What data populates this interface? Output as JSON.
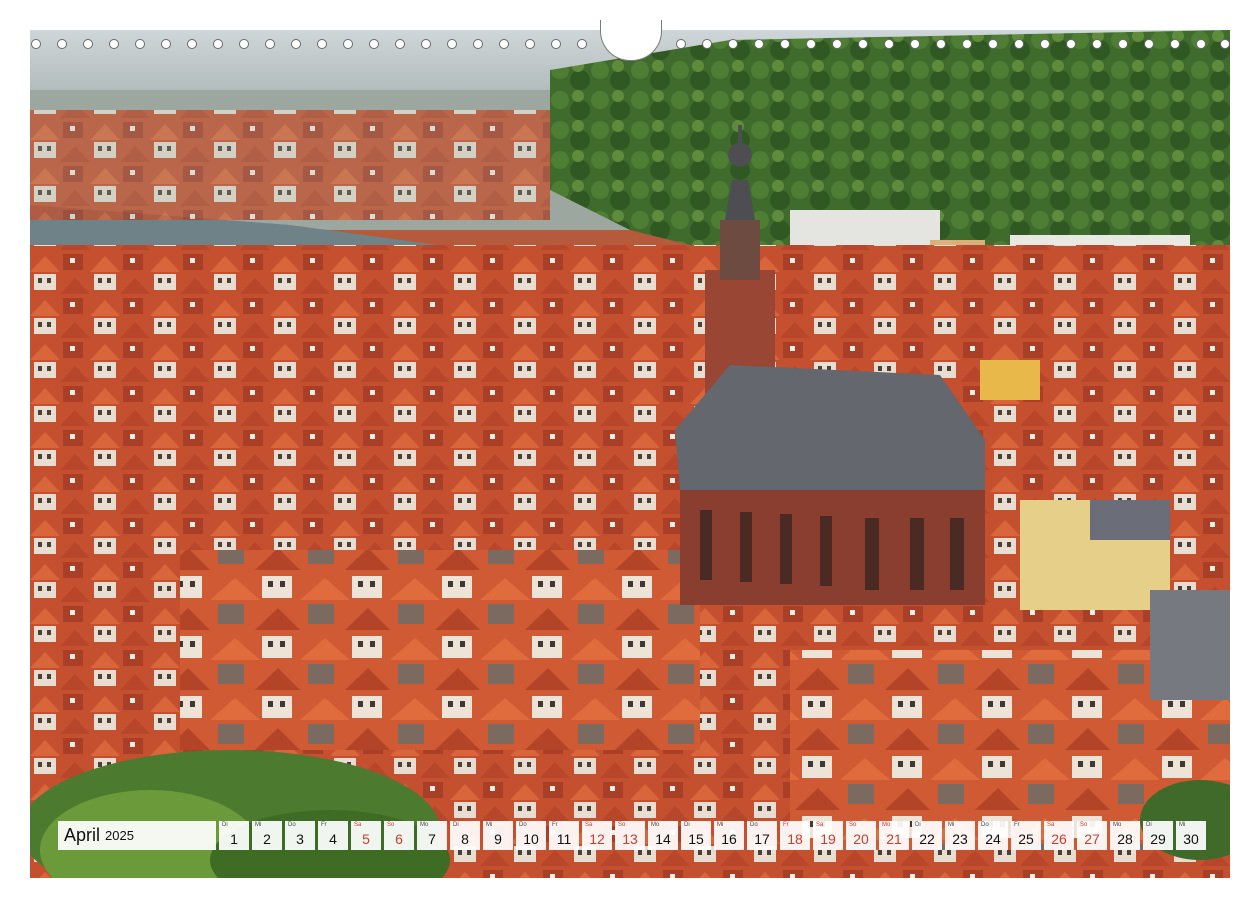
{
  "calendar": {
    "month": "April",
    "year": "2025",
    "days": [
      {
        "wd": "Di",
        "n": "1",
        "we": false
      },
      {
        "wd": "Mi",
        "n": "2",
        "we": false
      },
      {
        "wd": "Do",
        "n": "3",
        "we": false
      },
      {
        "wd": "Fr",
        "n": "4",
        "we": false
      },
      {
        "wd": "Sa",
        "n": "5",
        "we": true
      },
      {
        "wd": "So",
        "n": "6",
        "we": true
      },
      {
        "wd": "Mo",
        "n": "7",
        "we": false
      },
      {
        "wd": "Di",
        "n": "8",
        "we": false
      },
      {
        "wd": "Mi",
        "n": "9",
        "we": false
      },
      {
        "wd": "Do",
        "n": "10",
        "we": false
      },
      {
        "wd": "Fr",
        "n": "11",
        "we": false
      },
      {
        "wd": "Sa",
        "n": "12",
        "we": true
      },
      {
        "wd": "So",
        "n": "13",
        "we": true
      },
      {
        "wd": "Mo",
        "n": "14",
        "we": false
      },
      {
        "wd": "Di",
        "n": "15",
        "we": false
      },
      {
        "wd": "Mi",
        "n": "16",
        "we": false
      },
      {
        "wd": "Do",
        "n": "17",
        "we": false
      },
      {
        "wd": "Fr",
        "n": "18",
        "we": true
      },
      {
        "wd": "Sa",
        "n": "19",
        "we": true
      },
      {
        "wd": "So",
        "n": "20",
        "we": true
      },
      {
        "wd": "Mo",
        "n": "21",
        "we": true
      },
      {
        "wd": "Di",
        "n": "22",
        "we": false
      },
      {
        "wd": "Mi",
        "n": "23",
        "we": false
      },
      {
        "wd": "Do",
        "n": "24",
        "we": false
      },
      {
        "wd": "Fr",
        "n": "25",
        "we": false
      },
      {
        "wd": "Sa",
        "n": "26",
        "we": true
      },
      {
        "wd": "So",
        "n": "27",
        "we": true
      },
      {
        "wd": "Mo",
        "n": "28",
        "we": false
      },
      {
        "wd": "Di",
        "n": "29",
        "we": false
      },
      {
        "wd": "Mi",
        "n": "30",
        "we": false
      }
    ]
  },
  "colors": {
    "holiday_weekend": "#d13a2b",
    "roof_terracotta": "#c8502e",
    "forest": "#3e6a2a",
    "river": "#6f8288",
    "church_sandstone": "#8a3e30"
  },
  "icons": {
    "binding": "spiral-ring-holes",
    "hanger": "hanging-notch"
  }
}
